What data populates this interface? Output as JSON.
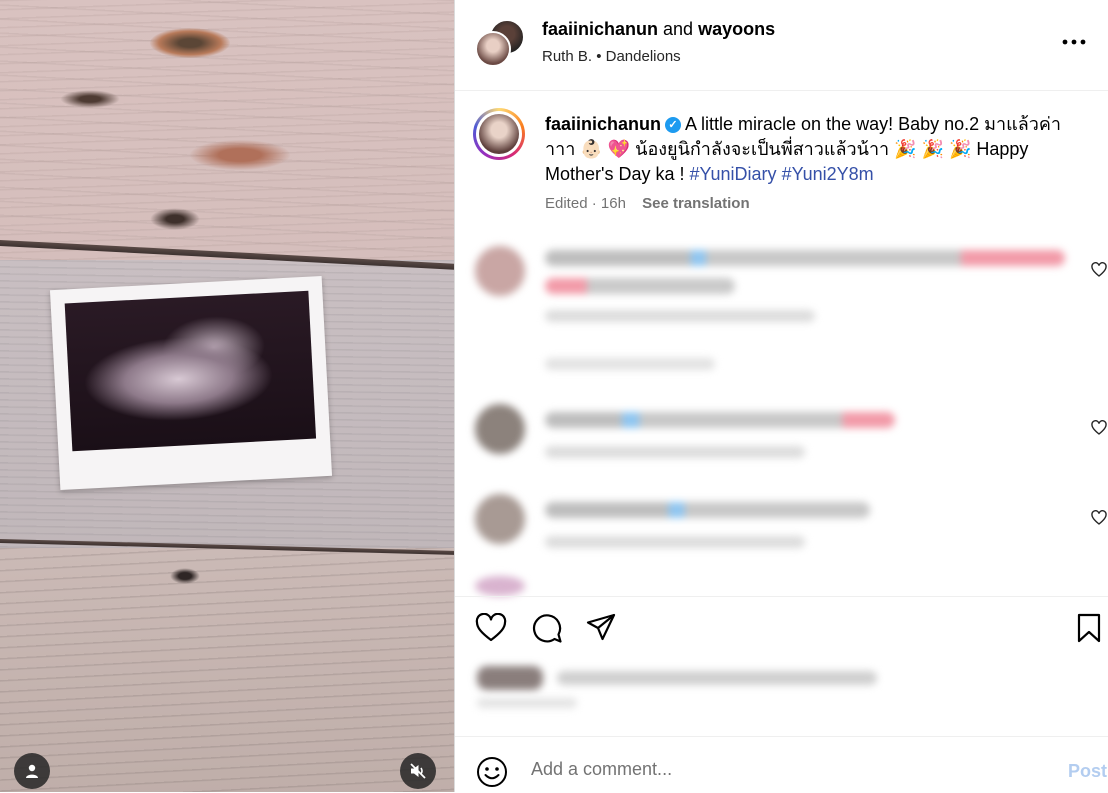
{
  "header": {
    "author": "faaiinichanun",
    "joiner": "and",
    "coauthor": "wayoons",
    "music": "Ruth B. • Dandelions",
    "more_icon": "more-horizontal-icon"
  },
  "caption": {
    "username": "faaiinichanun",
    "text": "A little miracle on the way! Baby no.2 มาแล้วค่าาาา 👶🏻 💖 น้องยูนิกำลังจะเป็นพี่สาวแล้วน้าา 🎉 🎉 🎉 Happy Mother's Day ka !",
    "hashtags": [
      "#YuniDiary",
      "#Yuni2Y8m"
    ],
    "edited": "Edited",
    "time": "16h",
    "see_translation": "See translation"
  },
  "actions": {
    "icons": [
      "heart-icon",
      "comment-icon",
      "share-icon",
      "bookmark-icon"
    ]
  },
  "add_comment": {
    "placeholder": "Add a comment...",
    "post_label": "Post"
  },
  "colors": {
    "link": "#3550a8",
    "verified": "#1d9bf0",
    "post_disabled": "#b3cdf0",
    "muted_text": "#737373"
  }
}
